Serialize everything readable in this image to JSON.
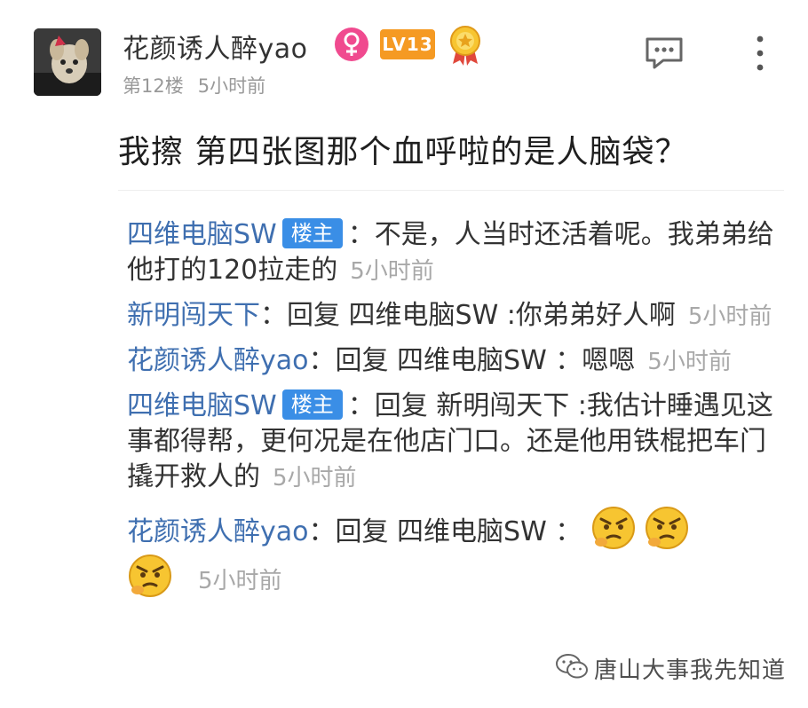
{
  "header": {
    "username": "花颜诱人醉yao",
    "gender_icon": "female-symbol",
    "level_badge": "LV13",
    "medal_icon": "gold-medal-icon",
    "floor": "第12楼",
    "time": "5小时前"
  },
  "comment": {
    "text": "我擦 第四张图那个血呼啦的是人脑袋？"
  },
  "replies": [
    {
      "author": "四维电脑SW",
      "tag": "楼主",
      "text": "：不是，人当时还活着呢。我弟弟给他打的120拉走的",
      "time": "5小时前"
    },
    {
      "author": "新明闯天下",
      "text": "：回复 四维电脑SW :你弟弟好人啊",
      "time": "5小时前"
    },
    {
      "author": "花颜诱人醉yao",
      "text": "：回复 四维电脑SW ：嗯嗯",
      "time": "5小时前"
    },
    {
      "author": "四维电脑SW",
      "tag": "楼主",
      "text": "：回复 新明闯天下 :我估计睡遇见这事都得帮，更何况是在他店门口。还是他用铁棍把车门撬开救人的",
      "time": "5小时前"
    },
    {
      "author": "花颜诱人醉yao",
      "text": "：回复 四维电脑SW ：",
      "emoji": "angry-thinking-emoji",
      "time": "5小时前"
    }
  ],
  "watermark": {
    "icon": "wechat-icon",
    "text": "唐山大事我先知道"
  },
  "colors": {
    "author": "#3f6fb0",
    "host_tag": "#3a8ee6",
    "level_badge": "#f59a23",
    "gender_badge": "#f04a8f",
    "time": "#a8a8a8"
  }
}
